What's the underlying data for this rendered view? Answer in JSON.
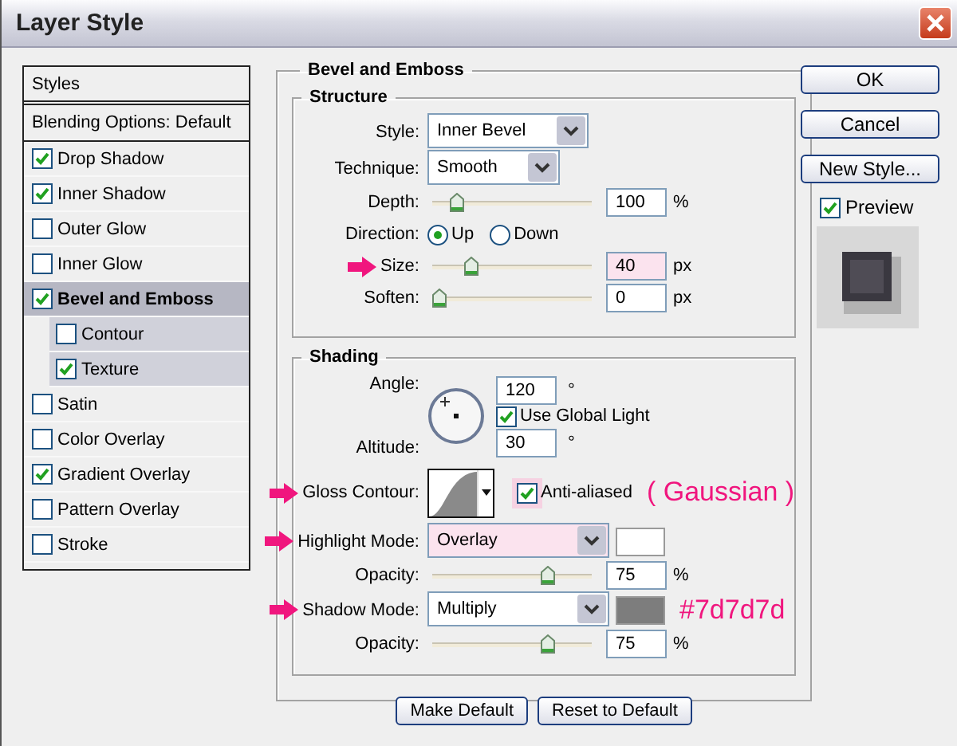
{
  "window": {
    "title": "Layer Style"
  },
  "styles_panel": {
    "header": "Styles",
    "items": [
      {
        "label": "Blending Options: Default",
        "kind": "plain",
        "selected": false
      },
      {
        "label": "Drop Shadow",
        "kind": "check",
        "checked": true,
        "selected": false
      },
      {
        "label": "Inner Shadow",
        "kind": "check",
        "checked": true,
        "selected": false
      },
      {
        "label": "Outer Glow",
        "kind": "check",
        "checked": false,
        "selected": false
      },
      {
        "label": "Inner Glow",
        "kind": "check",
        "checked": false,
        "selected": false
      },
      {
        "label": "Bevel and Emboss",
        "kind": "check",
        "checked": true,
        "selected": true,
        "children": [
          {
            "label": "Contour",
            "checked": false,
            "selected": false
          },
          {
            "label": "Texture",
            "checked": true,
            "selected": false
          }
        ]
      },
      {
        "label": "Satin",
        "kind": "check",
        "checked": false,
        "selected": false
      },
      {
        "label": "Color Overlay",
        "kind": "check",
        "checked": false,
        "selected": false
      },
      {
        "label": "Gradient Overlay",
        "kind": "check",
        "checked": true,
        "selected": false
      },
      {
        "label": "Pattern Overlay",
        "kind": "check",
        "checked": false,
        "selected": false
      },
      {
        "label": "Stroke",
        "kind": "check",
        "checked": false,
        "selected": false
      }
    ]
  },
  "effect_panel": {
    "title": "Bevel and Emboss",
    "sections": [
      {
        "title": "Structure",
        "rows": [
          {
            "kind": "select",
            "label": "Style:",
            "value": "Inner Bevel"
          },
          {
            "kind": "select",
            "label": "Technique:",
            "value": "Smooth"
          },
          {
            "kind": "slider",
            "label": "Depth:",
            "level": 0.12,
            "value": "100",
            "unit": "%"
          },
          {
            "kind": "radio",
            "label": "Direction:",
            "options": [
              {
                "label": "Up",
                "selected": true
              },
              {
                "label": "Down",
                "selected": false
              }
            ]
          },
          {
            "kind": "slider",
            "label": "Size:",
            "level": 0.22,
            "value": "40",
            "unit": "px",
            "annotated": true,
            "highlighted": true
          },
          {
            "kind": "slider",
            "label": "Soften:",
            "level": 0,
            "value": "0",
            "unit": "px"
          }
        ]
      },
      {
        "title": "Shading",
        "rows": [
          {
            "kind": "angle",
            "label": "Angle:",
            "value": "120",
            "unit": "°",
            "global_light": {
              "label": "Use Global Light",
              "checked": true
            },
            "altitude": {
              "label": "Altitude:",
              "value": "30",
              "unit": "°"
            }
          },
          {
            "kind": "contour",
            "label": "Gloss Contour:",
            "annotated": true,
            "checkbox": {
              "label": "Anti-aliased",
              "checked": true,
              "highlighted": true
            },
            "note": "( Gaussian )"
          },
          {
            "kind": "mode",
            "label": "Highlight Mode:",
            "value": "Overlay",
            "annotated": true,
            "highlighted": true,
            "color": "#ffffff"
          },
          {
            "kind": "slider",
            "label": "Opacity:",
            "level": 0.75,
            "value": "75",
            "unit": "%"
          },
          {
            "kind": "mode",
            "label": "Shadow Mode:",
            "value": "Multiply",
            "annotated": true,
            "color": "#7d7d7d",
            "note": "#7d7d7d"
          },
          {
            "kind": "slider",
            "label": "Opacity:",
            "level": 0.75,
            "value": "75",
            "unit": "%"
          }
        ]
      }
    ],
    "buttons": [
      "Make Default",
      "Reset to Default"
    ]
  },
  "actions": {
    "buttons": [
      "OK",
      "Cancel",
      "New Style..."
    ],
    "preview": {
      "label": "Preview",
      "checked": true
    }
  }
}
